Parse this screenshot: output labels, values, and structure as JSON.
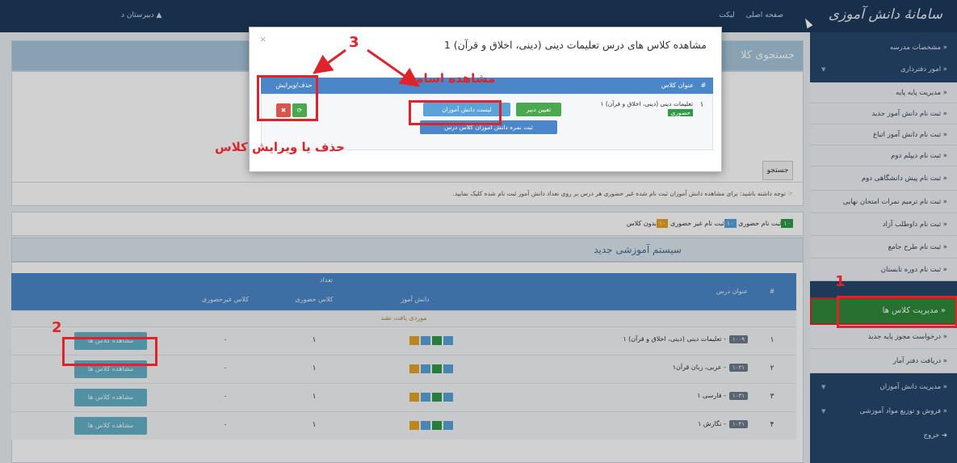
{
  "topbar": {
    "logo": "سامانهٔ دانش آموزی",
    "link_home": "صفحه اصلی",
    "link_logout": "لیکت",
    "school_label": "دبیرستان د"
  },
  "sidebar": {
    "items": [
      {
        "label": "مشخصات مدرسه",
        "style": "dark"
      },
      {
        "label": "امور دفترداری",
        "style": "dark"
      },
      {
        "label": "مدیریت پایه پایه",
        "style": "light"
      },
      {
        "label": "ثبت نام دانش آموز جدید",
        "style": "light"
      },
      {
        "label": "ثبت نام دانش آموز اتباع",
        "style": "light"
      },
      {
        "label": "ثبت نام دیپلم دوم",
        "style": "light"
      },
      {
        "label": "ثبت نام پیش دانشگاهی دوم",
        "style": "light"
      },
      {
        "label": "ثبت نام ترمیم نمرات امتحان نهایی",
        "style": "light"
      },
      {
        "label": "ثبت نام داوطلب آزاد",
        "style": "light"
      },
      {
        "label": "ثبت نام طرح جامع",
        "style": "light"
      },
      {
        "label": "ثبت نام دوره تابستان",
        "style": "light"
      },
      {
        "label": "مدیریت کلاس ها",
        "style": "active"
      },
      {
        "label": "درخواست مجوز پایه جدید",
        "style": "light"
      },
      {
        "label": "دریافت دفتر آمار",
        "style": "light"
      },
      {
        "label": "مدیریت دانش آموزان",
        "style": "dark"
      },
      {
        "label": "فروش و توزیع مواد آموزشی",
        "style": "dark"
      },
      {
        "label": "خروج",
        "style": "dark"
      }
    ]
  },
  "main": {
    "search_title": "جستجوی کلا",
    "search_button": "جستجو",
    "notice": "توجه داشته باشید: برای مشاهده دانش آموزان ثبت نام شده غیر حضوری هر درس بر روی تعداد دانش آموز ثبت نام شده کلیک نمایید.",
    "legend_present": "ثبت نام حضوری",
    "legend_absent": "ثبت نام غیر حضوری",
    "legend_noclass": "بدون کلاس",
    "section_title": "سیستم آموزشی جدید",
    "table": {
      "col_index": "#",
      "col_title": "عنوان درس",
      "col_count_group": "تعداد",
      "col_students": "دانش آموز",
      "col_class_present": "کلاس حضوری",
      "col_class_absent": "کلاس غیرحضوری",
      "no_record": "موردی یافت نشد",
      "rows": [
        {
          "index": "۱",
          "code": "۱۰۰۹",
          "title": "- تعلیمات دینی (دینی، اخلاق و قرآن) ۱",
          "present": "۱",
          "absent": "۰",
          "button": "مشاهده کلاس ها"
        },
        {
          "index": "۲",
          "code": "۱۰۲۱",
          "title": "- عربی، زبان قرآن۱",
          "present": "۱",
          "absent": "۰",
          "button": "مشاهده کلاس ها"
        },
        {
          "index": "۳",
          "code": "۱۰۳۱",
          "title": "- فارسی ۱",
          "present": "۱",
          "absent": "۰",
          "button": "مشاهده کلاس ها"
        },
        {
          "index": "۴",
          "code": "۱۰۴۱",
          "title": "- نگارش ۱",
          "present": "۱",
          "absent": "۰",
          "button": "مشاهده کلاس ها"
        }
      ]
    }
  },
  "modal": {
    "title": "مشاهده کلاس های درس تعلیمات دینی (دینی، اخلاق و قرآن) 1",
    "close": "×",
    "col_index": "#",
    "col_class_title": "عنوان کلاس",
    "col_edit": "حذف/ویرایش",
    "row_index": "۱",
    "row_class_title": "تعلیمات دینی (دینی، اخلاق و قرآن) ۱",
    "row_badge": "حضوری",
    "btn_teacher": "تعیین دبیر",
    "btn_students": "لیست دانش آموزان",
    "btn_grades": "ثبت نمره دانش آموزان کلاس درس",
    "btn_delete_icon": "✖",
    "btn_edit_icon": "⟳"
  },
  "annotations": {
    "label_view_names": "مشاهده اسامی",
    "label_delete_edit": "حذف یا ویرایش کلاس",
    "n1": "1",
    "n2": "2",
    "n3": "3"
  },
  "colors": {
    "topbar": "#1d3a5c",
    "sidebar": "#26476d",
    "table_header": "#4b87c8",
    "active_menu": "#2f8a3b",
    "annotation_red": "#e0232a",
    "view_button": "#64b0c8"
  }
}
